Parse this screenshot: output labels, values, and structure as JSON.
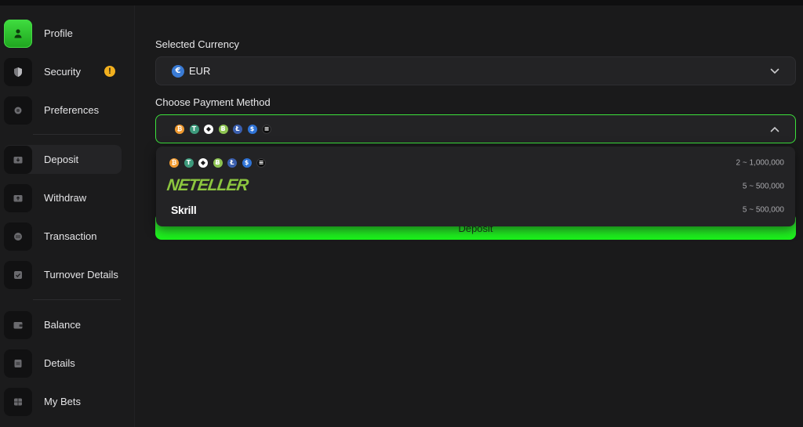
{
  "sidebar": {
    "items": [
      {
        "label": "Profile",
        "icon": "user-icon"
      },
      {
        "label": "Security",
        "icon": "shield-icon",
        "badge": "!"
      },
      {
        "label": "Preferences",
        "icon": "preferences-icon"
      },
      {
        "label": "Deposit",
        "icon": "deposit-icon"
      },
      {
        "label": "Withdraw",
        "icon": "withdraw-icon"
      },
      {
        "label": "Transaction",
        "icon": "transaction-icon"
      },
      {
        "label": "Turnover Details",
        "icon": "turnover-icon"
      },
      {
        "label": "Balance",
        "icon": "wallet-icon"
      },
      {
        "label": "Details",
        "icon": "details-icon"
      },
      {
        "label": "My Bets",
        "icon": "bets-icon"
      }
    ]
  },
  "currency": {
    "label": "Selected Currency",
    "value": "EUR",
    "icon": "euro-coin-icon"
  },
  "payment": {
    "label": "Choose Payment Method",
    "coins": [
      {
        "name": "bitcoin-icon",
        "glyph": "₿",
        "color": "#f09a30"
      },
      {
        "name": "tether-icon",
        "glyph": "T",
        "color": "#3d9a7c"
      },
      {
        "name": "ethereum-icon",
        "glyph": "◆",
        "color": "#ffffff"
      },
      {
        "name": "bitcoin-cash-icon",
        "glyph": "Ƀ",
        "color": "#8dc351"
      },
      {
        "name": "litecoin-icon",
        "glyph": "Ł",
        "color": "#3b5fae"
      },
      {
        "name": "usdc-icon",
        "glyph": "$",
        "color": "#2f73d6"
      },
      {
        "name": "solana-icon",
        "glyph": "≡",
        "color": "#0d0d0d"
      }
    ],
    "options": [
      {
        "name": "Crypto",
        "range": "2 ~ 1,000,000"
      },
      {
        "name": "NETELLER",
        "range": "5 ~ 500,000"
      },
      {
        "name": "Skrill",
        "range": "5 ~ 500,000"
      }
    ]
  },
  "deposit_button": {
    "label": "Deposit"
  },
  "colors": {
    "accent": "#3ce23c",
    "background": "#1a1a1b",
    "panel": "#232325",
    "neteller": "#8cc63f",
    "warning": "#f2b01e"
  }
}
